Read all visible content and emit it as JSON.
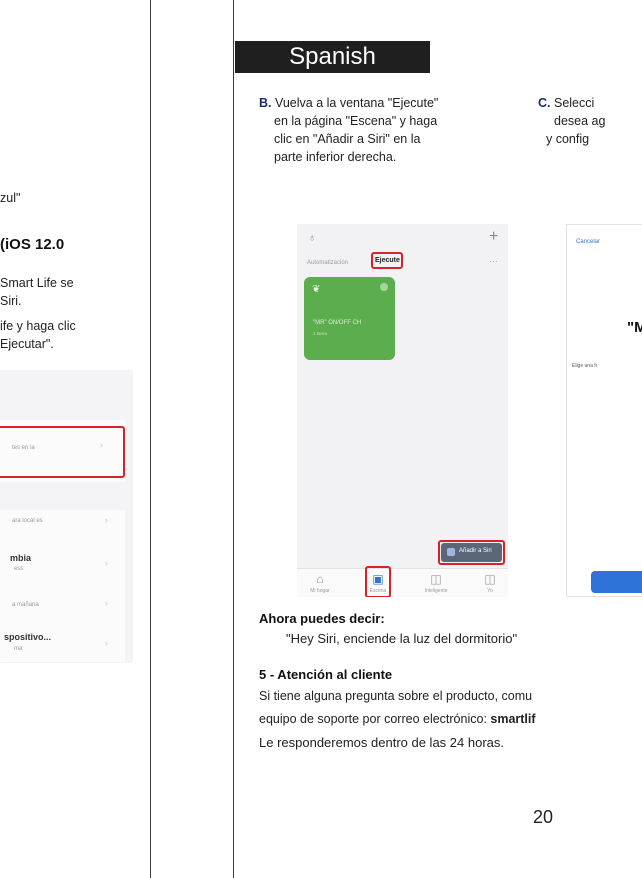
{
  "left_page": {
    "line1": "zul\"",
    "heading": "(iOS 12.0",
    "para1_line1": "Smart Life se",
    "para1_line2": "Siri.",
    "para2_line1": "ife y haga clic",
    "para2_line2": "Ejecutar\".",
    "screenshot": {
      "row1_small": "tes en la",
      "row2_small": "ara local es",
      "row3_bold": "mbia",
      "row3_small": "ess",
      "row4_small": "a mañana",
      "row5_bold": "spositivo...",
      "row5_small": "ma"
    }
  },
  "right_page": {
    "language": "Spanish",
    "step_b": {
      "letter": "B.",
      "lines": [
        "Vuelva a la ventana \"Ejecute\"",
        "en la página \"Escena\" y haga",
        "clic en \"Añadir a Siri\" en la",
        "parte inferior derecha."
      ]
    },
    "step_c": {
      "letter": "C.",
      "lines": [
        "Selecci",
        "desea ag",
        "y config"
      ]
    },
    "screenshot_b": {
      "tab_automation": "Automatización",
      "tab_execute": "Ejecute",
      "scene_name": "\"MR\" ON/OFF CH",
      "scene_sub": "1 tarea",
      "add_to_siri": "Añadir a Siri",
      "nav": [
        "Mi hogar",
        "Escena",
        "Inteligente",
        "Yo"
      ]
    },
    "screenshot_c": {
      "cancel": "Cancelar",
      "title_fragment": "\"M",
      "hint_fragment": "Elige una fr"
    },
    "now_say_label": "Ahora puedes decir:",
    "now_say_quote": "\"Hey Siri, enciende la luz del dormitorio\"",
    "section_title": "5 - Atención al cliente",
    "support_line1": "Si tiene alguna pregunta sobre el producto, comu",
    "support_line2_prefix": "equipo de soporte por correo electrónico: ",
    "support_email_fragment": "smartlif",
    "support_line3": "Le responderemos dentro de las 24 horas.",
    "page_number": "20"
  },
  "colors": {
    "highlight_red": "#d6222b",
    "scene_green": "#5cad4e",
    "siri_blue": "#2f73d8",
    "lang_bar": "#1f1f1f"
  }
}
